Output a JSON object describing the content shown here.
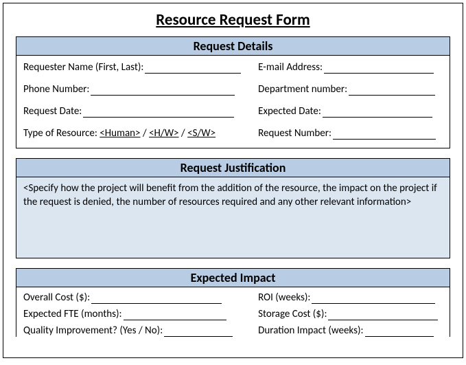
{
  "title": "Resource Request Form",
  "sections": {
    "details": {
      "header": "Request Details",
      "fields": {
        "requester_name": "Requester Name (First, Last):",
        "email": "E-mail Address:",
        "phone": "Phone Number:",
        "department": "Department number:",
        "request_date": "Request Date:",
        "expected_date": "Expected Date:",
        "type_label": "Type of Resource:",
        "type_opt1": "<Human>",
        "type_sep": " / ",
        "type_opt2": "<H/W>",
        "type_opt3": "<S/W>",
        "request_number": "Request Number:"
      }
    },
    "justification": {
      "header": "Request Justification",
      "placeholder": "<Specify how the project will benefit from the addition of the resource, the impact on the project if the request is denied, the number of resources required and any other relevant information>"
    },
    "impact": {
      "header": "Expected Impact",
      "fields": {
        "overall_cost": "Overall Cost ($):",
        "roi": "ROI (weeks):",
        "expected_fte": "Expected FTE (months):",
        "storage_cost": "Storage Cost ($):",
        "quality": "Quality Improvement? (Yes / No):",
        "duration": "Duration Impact (weeks):"
      }
    }
  }
}
